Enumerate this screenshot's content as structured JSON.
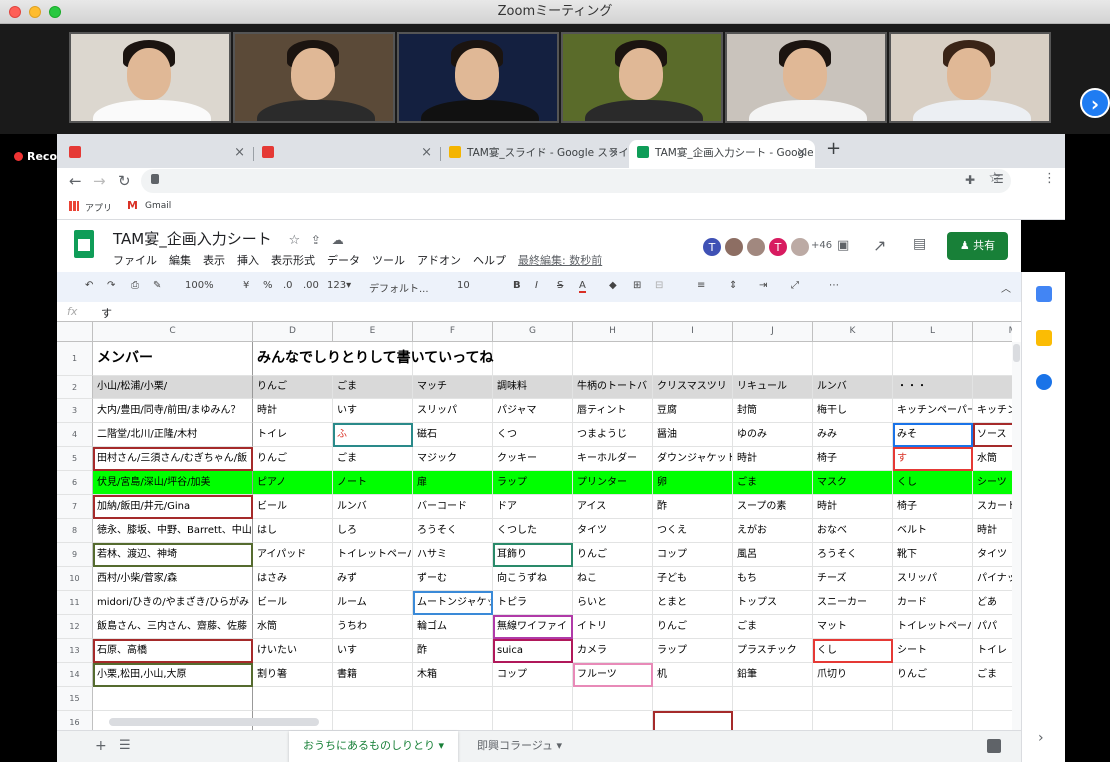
{
  "zoom": {
    "title": "Zoomミーティング",
    "recording": "Recording",
    "next_arrow": "›"
  },
  "browser": {
    "tabs": [
      {
        "label": ""
      },
      {
        "label": ""
      },
      {
        "label": "TAM宴_スライド - Google スライ"
      },
      {
        "label": "TAM宴_企画入力シート - Google"
      }
    ],
    "new_tab": "+",
    "back": "←",
    "forward": "→",
    "reload": "↻",
    "bookmarks": [
      {
        "label": "アプリ"
      },
      {
        "label": "Gmail"
      }
    ]
  },
  "sheets": {
    "title": "TAM宴_企画入力シート",
    "menu": [
      "ファイル",
      "編集",
      "表示",
      "挿入",
      "表示形式",
      "データ",
      "ツール",
      "アドオン",
      "ヘルプ"
    ],
    "last_edit": "最終編集: 数秒前",
    "avatars": [
      {
        "letter": "T",
        "color": "#3f51b5"
      },
      {
        "letter": "",
        "color": "#8d6e63"
      },
      {
        "letter": "",
        "color": "#a1887f"
      },
      {
        "letter": "T",
        "color": "#d81b60"
      },
      {
        "letter": "",
        "color": "#bcaaa4"
      }
    ],
    "more_users": "+46",
    "share": "共有",
    "zoom_level": "100%",
    "font": "デフォルト...",
    "font_size": "10",
    "formula": "す",
    "fx": "fx",
    "columns": [
      "C",
      "D",
      "E",
      "F",
      "G",
      "H",
      "I",
      "J",
      "K",
      "L",
      "M"
    ],
    "rows": [
      [
        "メンバー",
        "みんなでしりとりして書いていってね",
        "",
        "",
        "",
        "",
        "",
        "",
        "",
        "",
        ""
      ],
      [
        "小山/松浦/小栗/",
        "りんご",
        "ごま",
        "マッチ",
        "調味料",
        "牛柄のトートバ",
        "クリスマスツリ",
        "リキュール",
        "ルンバ",
        "・・・",
        ""
      ],
      [
        "大内/豊田/同寺/前田/まゆみん？",
        "時計",
        "いす",
        "スリッパ",
        "パジャマ",
        "唇ティント",
        "豆腐",
        "封筒",
        "梅干し",
        "キッチンペーパー",
        "キッチン"
      ],
      [
        "二階堂/北川/正隆/木村",
        "トイレ",
        "ふ",
        "磁石",
        "くつ",
        "つまようじ",
        "醤油",
        "ゆのみ",
        "みみ",
        "みそ",
        "ソース"
      ],
      [
        "田村さん/三須さん/むぎちゃん/飯",
        "りんご",
        "ごま",
        "マジック",
        "クッキー",
        "キーホルダー",
        "ダウンジャケット",
        "時計",
        "椅子",
        "す",
        "水筒"
      ],
      [
        "伏見/宮島/深山/坪谷/加美",
        "ピアノ",
        "ノート",
        "扉",
        "ラップ",
        "プリンター",
        "卵",
        "ごま",
        "マスク",
        "くし",
        "シーツ"
      ],
      [
        "加納/飯田/井元/Gina",
        "ビール",
        "ルンバ",
        "バーコード",
        "ドア",
        "アイス",
        "酢",
        "スープの素",
        "時計",
        "椅子",
        "スカート"
      ],
      [
        "徳永、膝坂、中野、Barrett、中山",
        "はし",
        "しろ",
        "ろうそく",
        "くつした",
        "タイツ",
        "つくえ",
        "えがお",
        "おなべ",
        "ベルト",
        "時計"
      ],
      [
        "若林、渡辺、神埼",
        "アイパッド",
        "トイレットペーパー",
        "ハサミ",
        "耳飾り",
        "りんご",
        "コップ",
        "風呂",
        "ろうそく",
        "靴下",
        "タイツ"
      ],
      [
        "西村/小柴/菅家/森",
        "はさみ",
        "みず",
        "ずーむ",
        "向こうずね",
        "ねこ",
        "子ども",
        "もち",
        "チーズ",
        "スリッパ",
        "パイナップル"
      ],
      [
        "midori/ひきの/やまざき/ひらがみ",
        "ビール",
        "ルーム",
        "ムートンジャケット",
        "トピラ",
        "らいと",
        "とまと",
        "トップス",
        "スニーカー",
        "カード",
        "どあ"
      ],
      [
        "飯島さん、三内さん、齋藤、佐藤",
        "水筒",
        "うちわ",
        "輪ゴム",
        "無線ワイファイ",
        "イトリ",
        "りんご",
        "ごま",
        "マット",
        "トイレットペーパー",
        "パパ"
      ],
      [
        "石原、高橋",
        "けいたい",
        "いす",
        "酢",
        "suica",
        "カメラ",
        "ラップ",
        "プラスチック",
        "くし",
        "シート",
        "トイレ"
      ],
      [
        "小栗,松田,小山,大原",
        "割り箸",
        "書籍",
        "木箱",
        "コップ",
        "フルーツ",
        "机",
        "鉛筆",
        "爪切り",
        "りんご",
        "ごま"
      ],
      [
        "",
        "",
        "",
        "",
        "",
        "",
        "",
        "",
        "",
        "",
        ""
      ],
      [
        "",
        "",
        "",
        "",
        "",
        "",
        "",
        "",
        "",
        "",
        ""
      ]
    ],
    "sheet_tabs": [
      {
        "label": "おうちにあるものしりとり"
      },
      {
        "label": "即興コラージュ"
      }
    ],
    "colors": {
      "green_row": "#00ff00",
      "header_row": "#d9d9d9",
      "accent": "#188038"
    }
  }
}
